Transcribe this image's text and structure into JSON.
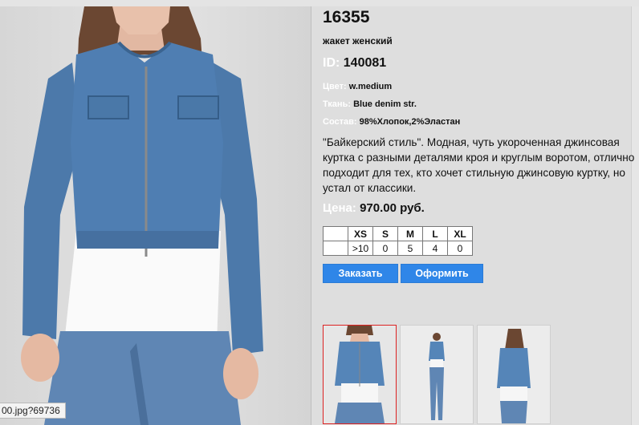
{
  "product": {
    "article": "16355",
    "name": "жакет женский",
    "id_label": "ID:",
    "id_value": "140081",
    "color_label": "Цвет:",
    "color_value": "w.medium",
    "fabric_label": "Ткань:",
    "fabric_value": "Blue denim str.",
    "composition_label": "Состав:",
    "composition_value": "98%Хлопок,2%Эластан",
    "description": "\"Байкерский стиль\". Модная, чуть укороченная  джинсовая куртка с разными деталями кроя и круглым воротом, отлично подходит для тех, кто хочет стильную джинсовую куртку, но устал от классики.",
    "price_label": "Цена:",
    "price_value": "970.00 руб."
  },
  "sizes": {
    "headers": [
      "XS",
      "S",
      "M",
      "L",
      "XL"
    ],
    "stock": [
      ">10",
      "0",
      "5",
      "4",
      "0"
    ]
  },
  "actions": {
    "order_label": "Заказать",
    "checkout_label": "Оформить"
  },
  "status_bar": {
    "url_text": "00.jpg?69736"
  },
  "colors": {
    "button_blue": "#2f86e8",
    "thumb_active_border": "#dd2222",
    "denim": "#4a77a8"
  }
}
